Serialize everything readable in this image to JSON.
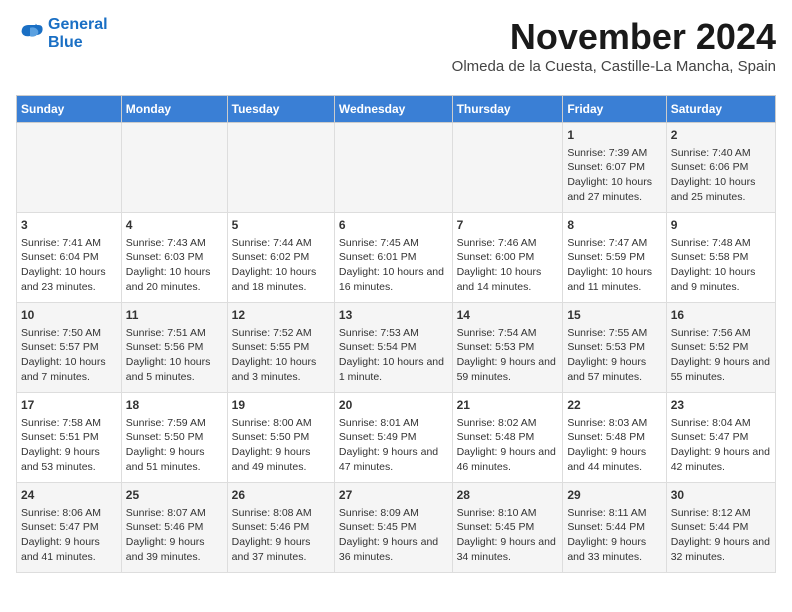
{
  "header": {
    "logo_line1": "General",
    "logo_line2": "Blue",
    "month": "November 2024",
    "location": "Olmeda de la Cuesta, Castille-La Mancha, Spain"
  },
  "weekdays": [
    "Sunday",
    "Monday",
    "Tuesday",
    "Wednesday",
    "Thursday",
    "Friday",
    "Saturday"
  ],
  "weeks": [
    [
      {
        "day": "",
        "info": ""
      },
      {
        "day": "",
        "info": ""
      },
      {
        "day": "",
        "info": ""
      },
      {
        "day": "",
        "info": ""
      },
      {
        "day": "",
        "info": ""
      },
      {
        "day": "1",
        "info": "Sunrise: 7:39 AM\nSunset: 6:07 PM\nDaylight: 10 hours and 27 minutes."
      },
      {
        "day": "2",
        "info": "Sunrise: 7:40 AM\nSunset: 6:06 PM\nDaylight: 10 hours and 25 minutes."
      }
    ],
    [
      {
        "day": "3",
        "info": "Sunrise: 7:41 AM\nSunset: 6:04 PM\nDaylight: 10 hours and 23 minutes."
      },
      {
        "day": "4",
        "info": "Sunrise: 7:43 AM\nSunset: 6:03 PM\nDaylight: 10 hours and 20 minutes."
      },
      {
        "day": "5",
        "info": "Sunrise: 7:44 AM\nSunset: 6:02 PM\nDaylight: 10 hours and 18 minutes."
      },
      {
        "day": "6",
        "info": "Sunrise: 7:45 AM\nSunset: 6:01 PM\nDaylight: 10 hours and 16 minutes."
      },
      {
        "day": "7",
        "info": "Sunrise: 7:46 AM\nSunset: 6:00 PM\nDaylight: 10 hours and 14 minutes."
      },
      {
        "day": "8",
        "info": "Sunrise: 7:47 AM\nSunset: 5:59 PM\nDaylight: 10 hours and 11 minutes."
      },
      {
        "day": "9",
        "info": "Sunrise: 7:48 AM\nSunset: 5:58 PM\nDaylight: 10 hours and 9 minutes."
      }
    ],
    [
      {
        "day": "10",
        "info": "Sunrise: 7:50 AM\nSunset: 5:57 PM\nDaylight: 10 hours and 7 minutes."
      },
      {
        "day": "11",
        "info": "Sunrise: 7:51 AM\nSunset: 5:56 PM\nDaylight: 10 hours and 5 minutes."
      },
      {
        "day": "12",
        "info": "Sunrise: 7:52 AM\nSunset: 5:55 PM\nDaylight: 10 hours and 3 minutes."
      },
      {
        "day": "13",
        "info": "Sunrise: 7:53 AM\nSunset: 5:54 PM\nDaylight: 10 hours and 1 minute."
      },
      {
        "day": "14",
        "info": "Sunrise: 7:54 AM\nSunset: 5:53 PM\nDaylight: 9 hours and 59 minutes."
      },
      {
        "day": "15",
        "info": "Sunrise: 7:55 AM\nSunset: 5:53 PM\nDaylight: 9 hours and 57 minutes."
      },
      {
        "day": "16",
        "info": "Sunrise: 7:56 AM\nSunset: 5:52 PM\nDaylight: 9 hours and 55 minutes."
      }
    ],
    [
      {
        "day": "17",
        "info": "Sunrise: 7:58 AM\nSunset: 5:51 PM\nDaylight: 9 hours and 53 minutes."
      },
      {
        "day": "18",
        "info": "Sunrise: 7:59 AM\nSunset: 5:50 PM\nDaylight: 9 hours and 51 minutes."
      },
      {
        "day": "19",
        "info": "Sunrise: 8:00 AM\nSunset: 5:50 PM\nDaylight: 9 hours and 49 minutes."
      },
      {
        "day": "20",
        "info": "Sunrise: 8:01 AM\nSunset: 5:49 PM\nDaylight: 9 hours and 47 minutes."
      },
      {
        "day": "21",
        "info": "Sunrise: 8:02 AM\nSunset: 5:48 PM\nDaylight: 9 hours and 46 minutes."
      },
      {
        "day": "22",
        "info": "Sunrise: 8:03 AM\nSunset: 5:48 PM\nDaylight: 9 hours and 44 minutes."
      },
      {
        "day": "23",
        "info": "Sunrise: 8:04 AM\nSunset: 5:47 PM\nDaylight: 9 hours and 42 minutes."
      }
    ],
    [
      {
        "day": "24",
        "info": "Sunrise: 8:06 AM\nSunset: 5:47 PM\nDaylight: 9 hours and 41 minutes."
      },
      {
        "day": "25",
        "info": "Sunrise: 8:07 AM\nSunset: 5:46 PM\nDaylight: 9 hours and 39 minutes."
      },
      {
        "day": "26",
        "info": "Sunrise: 8:08 AM\nSunset: 5:46 PM\nDaylight: 9 hours and 37 minutes."
      },
      {
        "day": "27",
        "info": "Sunrise: 8:09 AM\nSunset: 5:45 PM\nDaylight: 9 hours and 36 minutes."
      },
      {
        "day": "28",
        "info": "Sunrise: 8:10 AM\nSunset: 5:45 PM\nDaylight: 9 hours and 34 minutes."
      },
      {
        "day": "29",
        "info": "Sunrise: 8:11 AM\nSunset: 5:44 PM\nDaylight: 9 hours and 33 minutes."
      },
      {
        "day": "30",
        "info": "Sunrise: 8:12 AM\nSunset: 5:44 PM\nDaylight: 9 hours and 32 minutes."
      }
    ]
  ]
}
